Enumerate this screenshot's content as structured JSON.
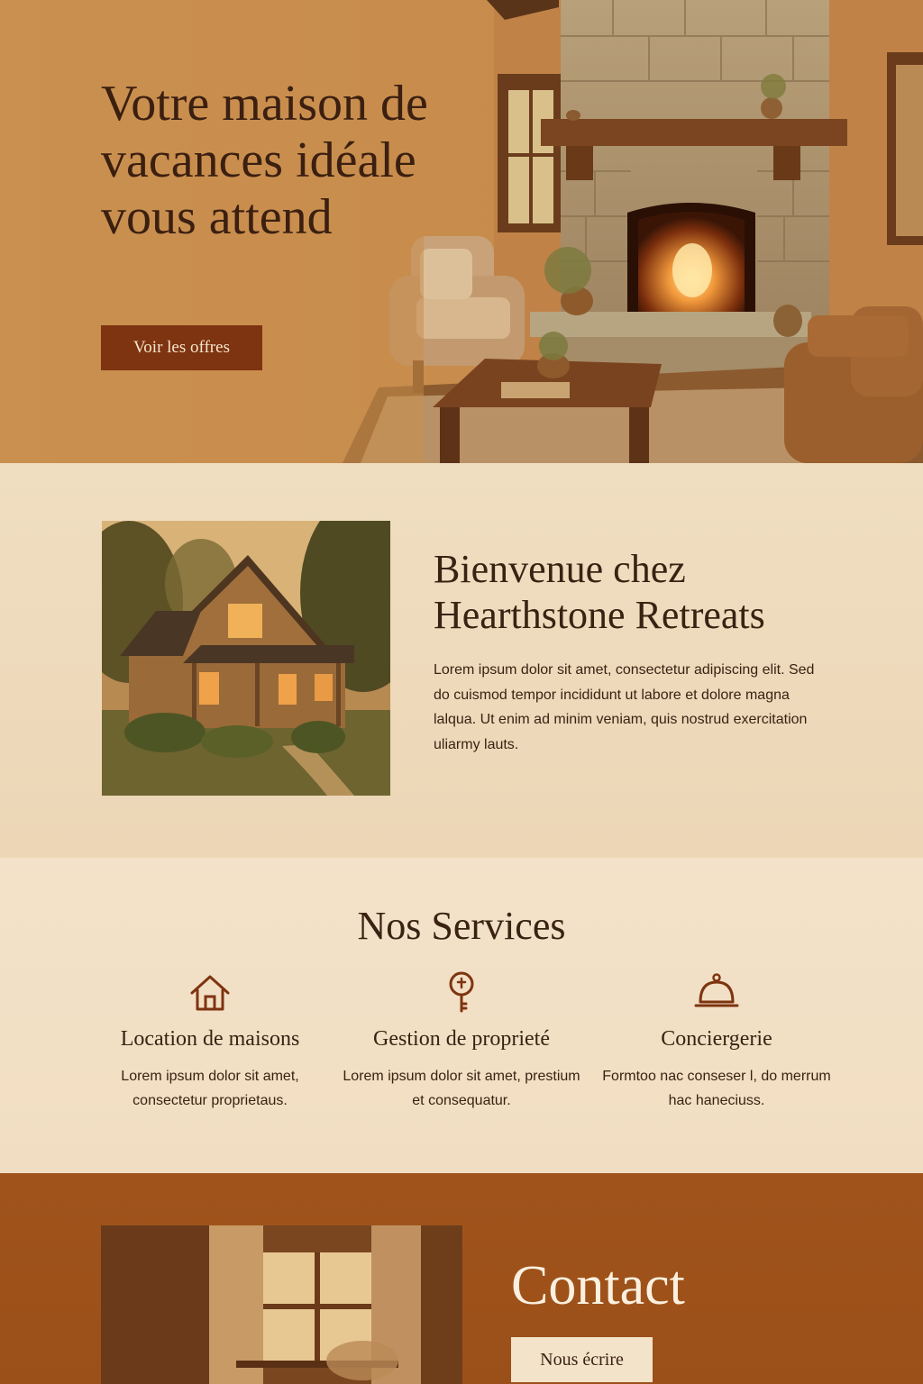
{
  "hero": {
    "title": "Votre maison de vacances idéale vous attend",
    "button_label": "Voir les offres"
  },
  "welcome": {
    "title": "Bienvenue chez Hearthstone Retreats",
    "text": "Lorem ipsum dolor sit amet, consectetur adipiscing elit. Sed do cuismod tempor incididunt ut labore et dolore magna lalqua. Ut enim ad minim veniam, quis nostrud exercitation uliarmy lauts."
  },
  "services": {
    "title": "Nos Services",
    "items": [
      {
        "icon": "house-icon",
        "title": "Location de maisons",
        "text": "Lorem ipsum dolor sit amet, consectetur proprietaus."
      },
      {
        "icon": "key-icon",
        "title": "Gestion de proprieté",
        "text": "Lorem ipsum dolor sit amet, prestium et consequatur."
      },
      {
        "icon": "cloche-icon",
        "title": "Conciergerie",
        "text": "Formtoo nac conseser l, do merrum hac haneciuss."
      }
    ]
  },
  "contact": {
    "title": "Contact",
    "button_label": "Nous écrire"
  },
  "colors": {
    "accent": "#7e3410",
    "dark_text": "#3a2213",
    "contact_bg": "#a0541c",
    "cream": "#f1dfc3"
  }
}
